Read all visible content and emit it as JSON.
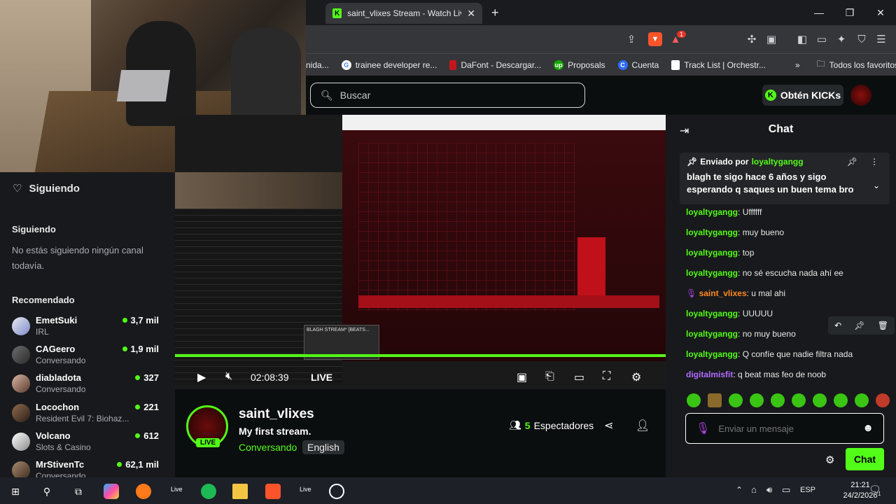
{
  "browser": {
    "tab_title": "saint_vlixes Stream - Watch Live",
    "bookmarks": [
      {
        "label": "nida...",
        "icon": ""
      },
      {
        "label": "trainee developer re...",
        "icon": "G"
      },
      {
        "label": "DaFont - Descargar...",
        "icon": ""
      },
      {
        "label": "Proposals",
        "icon": "up"
      },
      {
        "label": "Cuenta",
        "icon": "C"
      },
      {
        "label": "Track List | Orchestr...",
        "icon": ""
      }
    ],
    "all_bookmarks": "Todos los favoritos",
    "brave_badge": "1"
  },
  "header": {
    "search_placeholder": "Buscar",
    "kicks_label": "Obtén KICKs"
  },
  "sidebar": {
    "following_title": "Siguiendo",
    "following_section": "Siguiendo",
    "empty_text": "No estás siguiendo ningún canal todavía.",
    "recommended_title": "Recomendado",
    "channels": [
      {
        "name": "EmetSuki",
        "category": "IRL",
        "viewers": "3,7 mil"
      },
      {
        "name": "CAGeero",
        "category": "Conversando",
        "viewers": "1,9 mil"
      },
      {
        "name": "diabladota",
        "category": "Conversando",
        "viewers": "327"
      },
      {
        "name": "Locochon",
        "category": "Resident Evil 7: Biohaz...",
        "viewers": "221"
      },
      {
        "name": "Volcano",
        "category": "Slots & Casino",
        "viewers": "612"
      },
      {
        "name": "MrStivenTc",
        "category": "Conversando",
        "viewers": "62,1 mil"
      }
    ]
  },
  "player": {
    "time": "02:08:39",
    "live_label": "LIVE",
    "popup_title": "BLAGH STREAM* [BEATS..."
  },
  "stream": {
    "live_badge": "LIVE",
    "channel_name": "saint_vlixes",
    "title": "My first stream.",
    "category": "Conversando",
    "language": "English",
    "viewer_count": "5",
    "viewer_label": "Espectadores"
  },
  "chat": {
    "title": "Chat",
    "pinned_prefix": "Enviado por",
    "pinned_user": "loyaltygangg",
    "pinned_message": "blagh te sigo hace 6 años y sigo esperando q saques un buen tema bro",
    "messages": [
      {
        "user": "loyaltygangg",
        "text": "Uffffff",
        "color": "#53fc18"
      },
      {
        "user": "loyaltygangg",
        "text": "muy bueno",
        "color": "#53fc18"
      },
      {
        "user": "loyaltygangg",
        "text": "top",
        "color": "#53fc18"
      },
      {
        "user": "loyaltygangg",
        "text": "no sé escucha nada ahí ee",
        "color": "#53fc18"
      },
      {
        "user": "saint_vlixes",
        "text": "u mal ahi",
        "color": "#ff8a1f"
      },
      {
        "user": "loyaltygangg",
        "text": "UUUUU",
        "color": "#53fc18"
      },
      {
        "user": "loyaltygangg",
        "text": "no muy bueno",
        "color": "#53fc18"
      },
      {
        "user": "loyaltygangg",
        "text": "Q confíe que nadie filtra nada",
        "color": "#53fc18"
      },
      {
        "user": "digitalmisfit",
        "text": "q beat mas feo de noob",
        "color": "#b06cff"
      }
    ],
    "input_placeholder": "Enviar un mensaje",
    "send_label": "Chat"
  },
  "taskbar": {
    "live_label_1": "Live",
    "live_label_2": "Live",
    "language": "ESP",
    "time": "21:21",
    "date": "24/2/2026",
    "notification_count": "1"
  },
  "colors": {
    "accent": "#53fc18",
    "background": "#0b0e0f",
    "panel": "#18191c"
  }
}
